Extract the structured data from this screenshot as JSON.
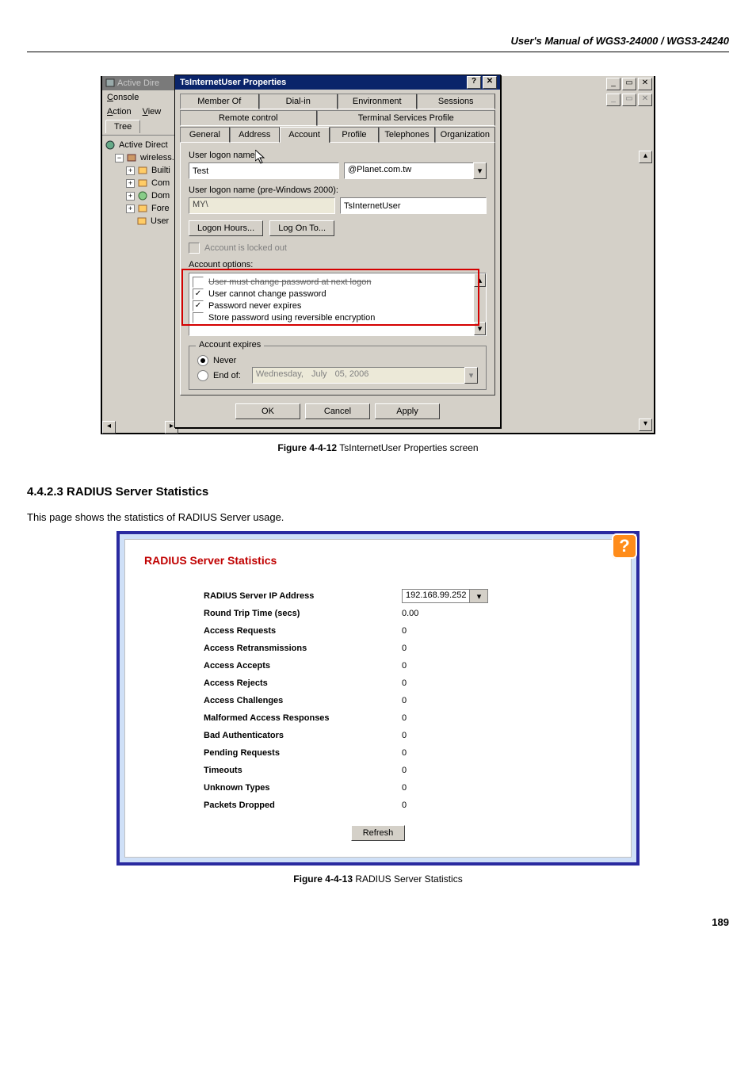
{
  "document": {
    "header": "User's  Manual  of  WGS3-24000  /  WGS3-24240",
    "page_number": "189",
    "section": {
      "number_title": "4.4.2.3 RADIUS Server Statistics",
      "intro": "This page shows the statistics of RADIUS Server usage."
    },
    "figure1_caption_bold": "Figure 4-4-12",
    "figure1_caption_text": " TsInternetUser Properties screen",
    "figure2_caption_bold": "Figure 4-4-13",
    "figure2_caption_text": " RADIUS Server Statistics"
  },
  "mmc": {
    "title": "Active Dire",
    "menu": {
      "console": "Console",
      "action": "Action",
      "view": "View"
    },
    "tree_tab": "Tree",
    "tree": {
      "root": "Active Direct",
      "domain": "wireless.",
      "nodes": [
        "Builti",
        "Com",
        "Dom",
        "Fore",
        "User"
      ]
    }
  },
  "dialog": {
    "title": "TsInternetUser Properties",
    "tabs_row1": [
      "Member Of",
      "Dial-in",
      "Environment",
      "Sessions"
    ],
    "tabs_row1b": [
      "Remote control",
      "Terminal Services Profile"
    ],
    "tabs_row2": [
      "General",
      "Address",
      "Account",
      "Profile",
      "Telephones",
      "Organization"
    ],
    "fields": {
      "upn_label": "User logon name:",
      "upn_value": "Test",
      "upn_suffix": "@Planet.com.tw",
      "sam_label": "User logon name (pre-Windows 2000):",
      "sam_domain": "MY\\",
      "sam_user": "TsInternetUser",
      "logon_hours_btn": "Logon Hours...",
      "log_on_to_btn": "Log On To...",
      "locked_out": "Account is locked out",
      "options_label": "Account options:",
      "opt1": "User must change password at next logon",
      "opt2": "User cannot change password",
      "opt3": "Password never expires",
      "opt4": "Store password using reversible encryption",
      "expires_legend": "Account expires",
      "never": "Never",
      "endof": "End of:",
      "endof_day": "Wednesday,",
      "endof_month": "July",
      "endof_date": "05, 2006"
    },
    "buttons": {
      "ok": "OK",
      "cancel": "Cancel",
      "apply": "Apply"
    }
  },
  "radius": {
    "heading": "RADIUS Server Statistics",
    "ip_selected": "192.168.99.252",
    "rows": [
      {
        "k": "RADIUS Server IP Address",
        "v": ""
      },
      {
        "k": "Round Trip Time (secs)",
        "v": "0.00"
      },
      {
        "k": "Access Requests",
        "v": "0"
      },
      {
        "k": "Access Retransmissions",
        "v": "0"
      },
      {
        "k": "Access Accepts",
        "v": "0"
      },
      {
        "k": "Access Rejects",
        "v": "0"
      },
      {
        "k": "Access Challenges",
        "v": "0"
      },
      {
        "k": "Malformed Access Responses",
        "v": "0"
      },
      {
        "k": "Bad Authenticators",
        "v": "0"
      },
      {
        "k": "Pending Requests",
        "v": "0"
      },
      {
        "k": "Timeouts",
        "v": "0"
      },
      {
        "k": "Unknown Types",
        "v": "0"
      },
      {
        "k": "Packets Dropped",
        "v": "0"
      }
    ],
    "refresh": "Refresh"
  }
}
